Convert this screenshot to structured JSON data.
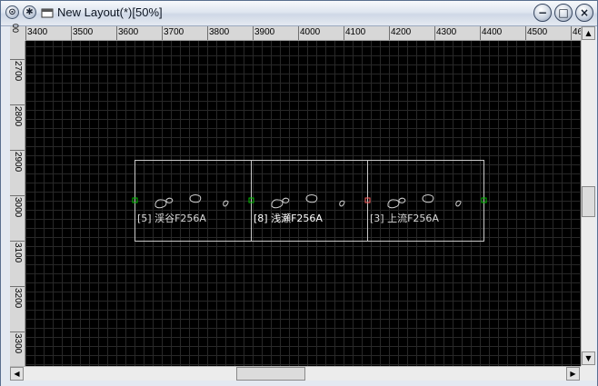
{
  "window": {
    "title": "New Layout(*)[50%]",
    "controls": [
      "minimize",
      "maximize",
      "close"
    ]
  },
  "ruler": {
    "corner_label": "00",
    "h_ticks": [
      "3400",
      "3500",
      "3600",
      "3700",
      "3800",
      "3900",
      "4000",
      "4100",
      "4200",
      "4300",
      "4400",
      "4500",
      "46"
    ],
    "v_ticks": [
      "2700",
      "2800",
      "2900",
      "3000",
      "3100",
      "3200",
      "3300"
    ]
  },
  "cells": [
    {
      "label": "[5] 渓谷F256A",
      "label_color": "#d8d8d8",
      "connector_right": "#00c000"
    },
    {
      "label": "[8] 浅瀬F256A",
      "label_color": "#ffffff",
      "connector_right": "#ff6060"
    },
    {
      "label": "[3] 上流F256A",
      "label_color": "#d8d8d8",
      "connector_right": "#00c000"
    }
  ],
  "colors": {
    "grid": "#282828",
    "layout_border": "#c8c8c8",
    "connector_left": "#00c000"
  },
  "scroll": {
    "vertical_position": 0.52,
    "horizontal_position": 0.45
  }
}
